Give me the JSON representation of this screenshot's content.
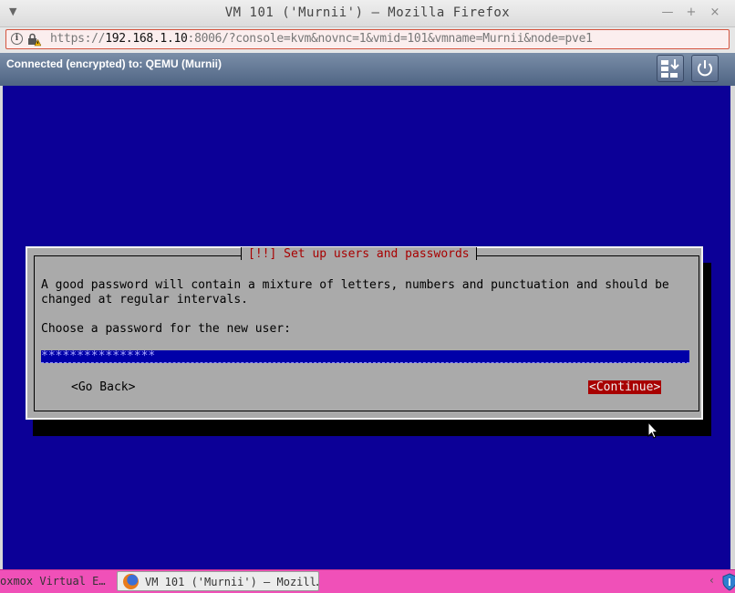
{
  "window": {
    "title": "VM 101 ('Murnii') — Mozilla Firefox",
    "menu_glyph": "▼",
    "controls": {
      "minimize": "—",
      "maximize": "+",
      "close": "×"
    }
  },
  "urlbar": {
    "url_prefix": "https://",
    "url_host": "192.168.1.10",
    "url_rest": ":8006/?console=kvm&novnc=1&vmid=101&vmname=Murnii&node=pve1",
    "info_glyph": "i"
  },
  "vnc": {
    "status": "Connected (encrypted) to: QEMU (Murnii)"
  },
  "installer": {
    "dialog_title": "[!!] Set up users and passwords",
    "description_line1": "A good password will contain a mixture of letters, numbers and punctuation and should be",
    "description_line2": "changed at regular intervals.",
    "prompt": "Choose a password for the new user:",
    "password_mask": "****************",
    "back_button": "<Go Back>",
    "continue_button": "<Continue>"
  },
  "taskbar": {
    "task1": "oxmox Virtual E…",
    "task2": "VM 101 ('Murnii') — Mozill…",
    "tray_chevron": "‹"
  },
  "colors": {
    "console_bg": "#0c0097",
    "dialog_bg": "#aaaaaa",
    "accent_red": "#a80000",
    "taskbar": "#f050b8",
    "url_border": "#d4543f"
  }
}
